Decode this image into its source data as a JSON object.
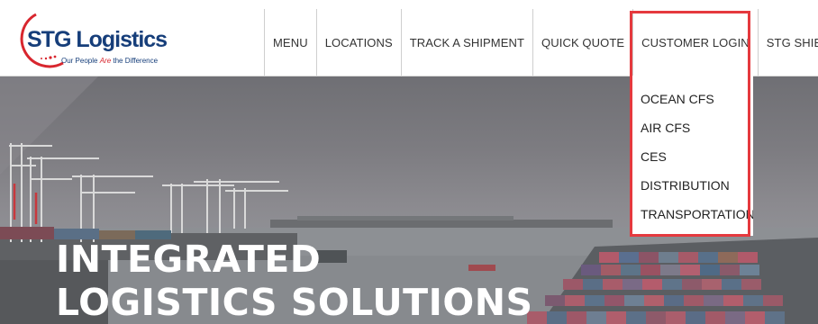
{
  "logo": {
    "brand": "STG Logistics",
    "tagline_start": "Our People ",
    "tagline_accent": "Are",
    "tagline_end": " the Difference"
  },
  "nav": {
    "items": [
      {
        "label": "MENU"
      },
      {
        "label": "LOCATIONS"
      },
      {
        "label": "TRACK A SHIPMENT"
      },
      {
        "label": "QUICK QUOTE"
      },
      {
        "label": "CUSTOMER LOGIN"
      },
      {
        "label": "STG SHIELD"
      }
    ]
  },
  "dropdown": {
    "items": [
      {
        "label": "OCEAN CFS"
      },
      {
        "label": "AIR CFS"
      },
      {
        "label": "CES"
      },
      {
        "label": "DISTRIBUTION"
      },
      {
        "label": "TRANSPORTATION"
      }
    ]
  },
  "hero": {
    "line1": "INTEGRATED",
    "line2": "LOGISTICS SOLUTIONS"
  },
  "colors": {
    "brand_blue": "#163e7a",
    "brand_red": "#d8262e",
    "highlight_red": "#e5393e"
  }
}
